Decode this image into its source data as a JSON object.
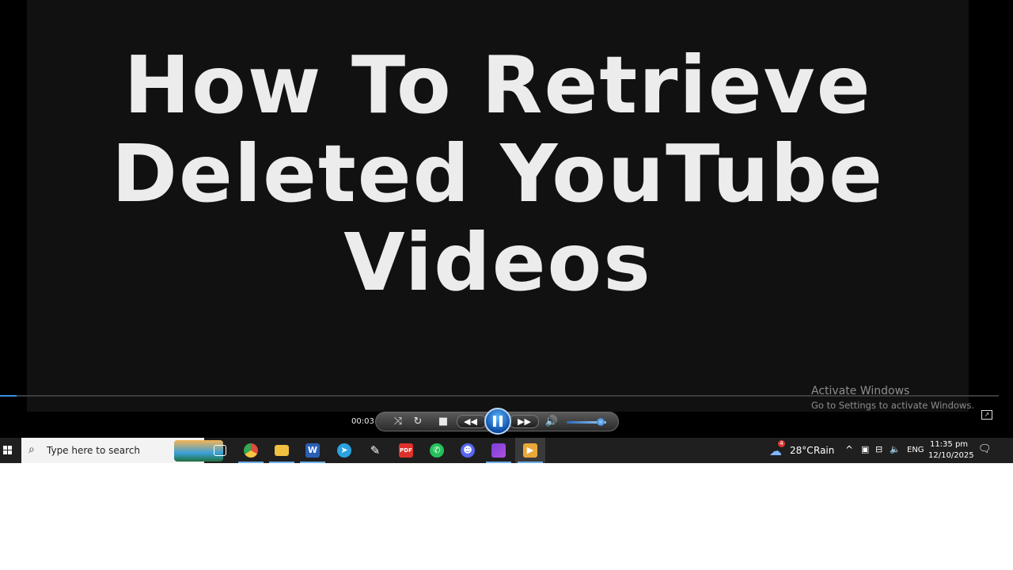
{
  "video": {
    "title_lines": [
      "How To Retrieve",
      "Deleted YouTube",
      "Videos"
    ],
    "elapsed": "00:03",
    "progress": 0.017,
    "volume": 0.85
  },
  "watermark": {
    "line1": "Activate Windows",
    "line2": "Go to Settings to activate Windows."
  },
  "taskbar": {
    "search_placeholder": "Type here to search",
    "weather_temp": "28°C",
    "weather_text": "Rain",
    "weather_badge": "4",
    "language": "ENG",
    "time": "11:35 pm",
    "date": "12/10/2025",
    "pinned_apps": [
      "task-view",
      "chrome",
      "file-explorer",
      "word",
      "telegram",
      "pen-app",
      "pdf-app",
      "whatsapp",
      "discord",
      "clipchamp",
      "media-player"
    ]
  },
  "colors": {
    "accent": "#3d8fe0",
    "taskbar_bg": "#1f1f1f",
    "video_bg": "#111111"
  }
}
